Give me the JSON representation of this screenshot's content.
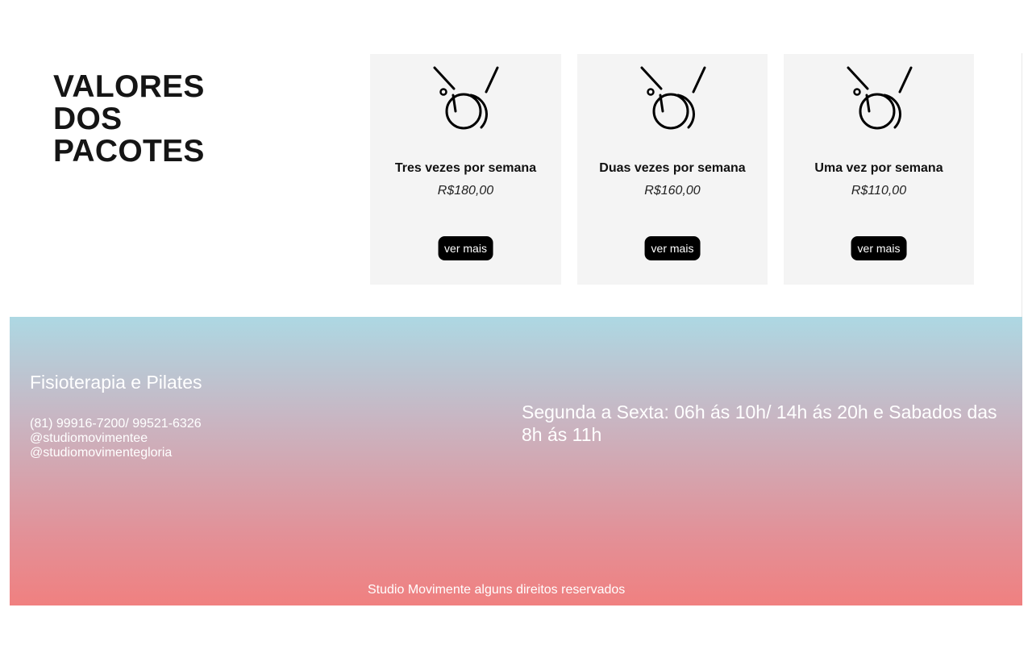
{
  "section": {
    "title": "VALORES\nDOS\nPACOTES"
  },
  "packages": [
    {
      "name": "Tres vezes por semana",
      "price": "R$180,00",
      "button_label": "ver mais",
      "icon": "pilates-ball-icon"
    },
    {
      "name": "Duas vezes por semana",
      "price": "R$160,00",
      "button_label": "ver mais",
      "icon": "pilates-ball-icon"
    },
    {
      "name": "Uma vez por semana",
      "price": "R$110,00",
      "button_label": "ver mais",
      "icon": "pilates-ball-icon"
    }
  ],
  "footer": {
    "brand": "Fisioterapia e Pilates",
    "phone": "(81) 99916-7200/ 99521-6326",
    "instagram_1": "@studiomovimentee",
    "instagram_2": "@studiomovimentegloria",
    "hours": "Segunda a Sexta: 06h ás 10h/ 14h ás 20h e Sabados das 8h ás 11h",
    "copyright": "Studio Movimente alguns direitos reservados"
  },
  "colors": {
    "card_bg": "#f4f4f4",
    "button_bg": "#000000",
    "footer_gradient_top": "#add8e3",
    "footer_gradient_bottom": "#f08080"
  }
}
